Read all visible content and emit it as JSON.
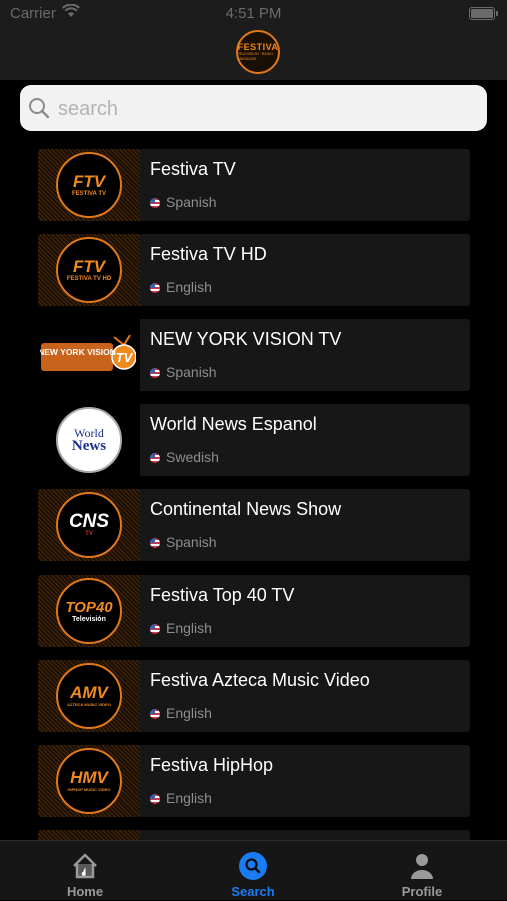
{
  "status_bar": {
    "carrier": "Carrier",
    "time": "4:51 PM"
  },
  "header": {
    "logo_line1": "FESTIVA",
    "logo_line2": "TELEVISION · RADIO · MAGAZINE"
  },
  "search": {
    "placeholder": "search",
    "value": ""
  },
  "channels": [
    {
      "name": "Festiva TV",
      "language": "Spanish",
      "thumb_text": "FTV",
      "thumb_sub": "FESTIVA TV"
    },
    {
      "name": "Festiva TV HD",
      "language": "English",
      "thumb_text": "FTV",
      "thumb_sub": "FESTIVA TV HD"
    },
    {
      "name": "NEW YORK VISION TV",
      "language": "Spanish",
      "thumb_text": "NEW YORK VISION",
      "thumb_sub": "TV"
    },
    {
      "name": "World News Espanol",
      "language": "Swedish",
      "thumb_text": "World",
      "thumb_sub": "News"
    },
    {
      "name": "Continental News Show",
      "language": "Spanish",
      "thumb_text": "CNS",
      "thumb_sub": "TV"
    },
    {
      "name": "Festiva Top 40 TV",
      "language": "English",
      "thumb_text": "TOP40",
      "thumb_sub": "Televisión"
    },
    {
      "name": "Festiva Azteca Music Video",
      "language": "English",
      "thumb_text": "AMV",
      "thumb_sub": "AZTECA MUSIC VIDEO"
    },
    {
      "name": "Festiva HipHop",
      "language": "English",
      "thumb_text": "HMV",
      "thumb_sub": "HIPHOP MUSIC VIDEO"
    }
  ],
  "tabs": [
    {
      "label": "Home",
      "icon": "home-icon",
      "active": false
    },
    {
      "label": "Search",
      "icon": "search-icon",
      "active": true
    },
    {
      "label": "Profile",
      "icon": "person-icon",
      "active": false
    }
  ],
  "colors": {
    "accent": "#1a7cf5",
    "brand_orange": "#f08a1f",
    "inactive_tab": "#9a9a9a"
  }
}
